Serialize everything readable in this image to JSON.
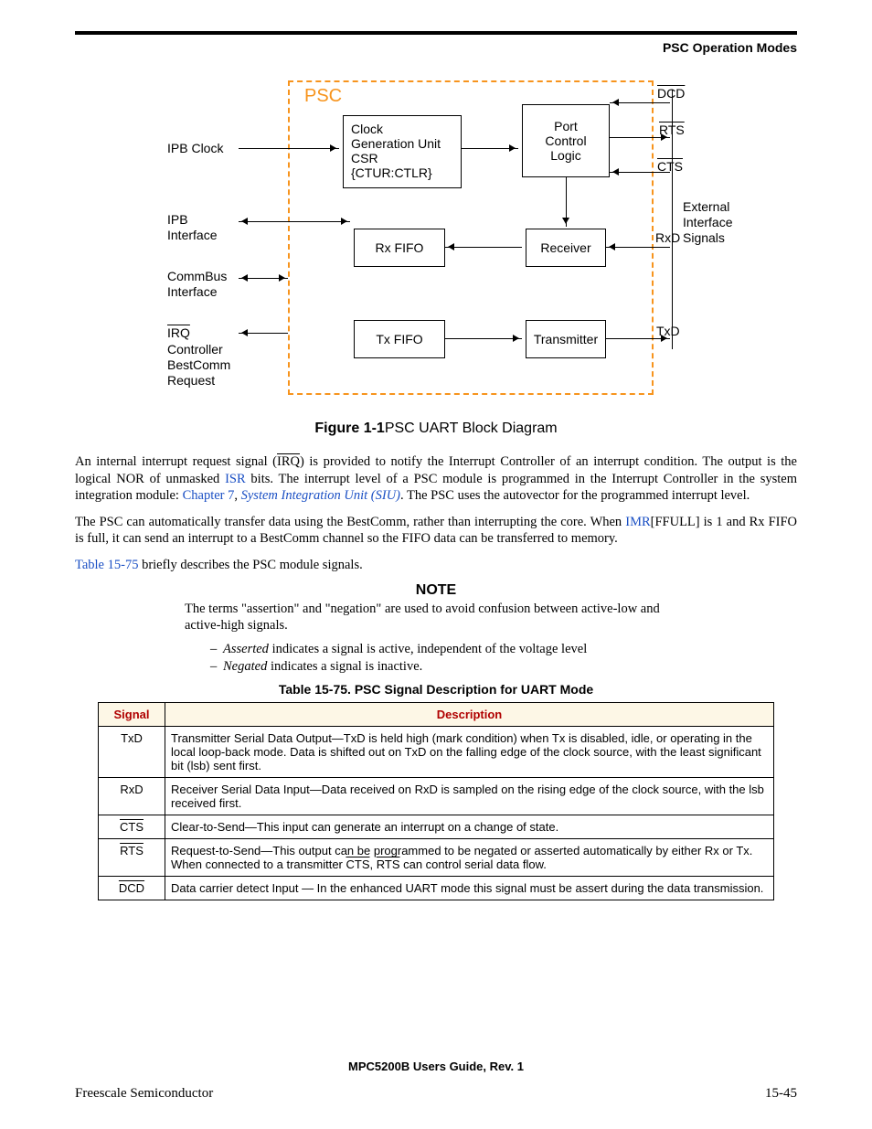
{
  "header": {
    "section": "PSC Operation Modes"
  },
  "figure": {
    "psc": "PSC",
    "left_labels": {
      "ipb_clock": "IPB Clock",
      "ipb_if": "IPB\nInterface",
      "commbus": "CommBus\nInterface",
      "irq": "IRQ",
      "ctrl": "Controller\nBestComm\nRequest"
    },
    "right_labels": {
      "dcd": "DCD",
      "rts": "RTS",
      "cts": "CTS",
      "rxd": "RxD",
      "ext": "External\nInterface\nSignals",
      "txd": "TxD"
    },
    "boxes": {
      "clock": "Clock\nGeneration Unit\nCSR\n{CTUR:CTLR}",
      "port": "Port\nControl\nLogic",
      "rxfifo": "Rx FIFO",
      "receiver": "Receiver",
      "txfifo": "Tx FIFO",
      "transmitter": "Transmitter"
    },
    "caption_bold": "Figure 1-1",
    "caption_rest": "PSC UART Block Diagram"
  },
  "para1": {
    "t1": "An internal interrupt request signal (",
    "irq": "IRQ",
    "t2": ") is provided to notify the Interrupt Controller of an interrupt condition. The output is the logical NOR of unmasked ",
    "isr": "ISR",
    "t3": " bits. The interrupt level of a PSC module is programmed in the Interrupt Controller in the system integration module: ",
    "ch7": "Chapter 7",
    "comma": ", ",
    "siu": "System Integration Unit (SIU)",
    "t4": ". The PSC uses the autovector for the programmed interrupt level."
  },
  "para2": {
    "t1": "The PSC can automatically transfer data using the BestComm, rather than interrupting the core. When ",
    "imr": "IMR",
    "t2": "[FFULL] is 1 and Rx FIFO is full, it can send an interrupt to a BestComm channel so the FIFO data can be transferred to memory."
  },
  "para3": {
    "tbl": "Table 15-75",
    "t1": " briefly describes the PSC module signals."
  },
  "note": {
    "title": "NOTE",
    "body": "The terms \"assertion\" and \"negation\" are used to avoid confusion between active-low and active-high signals.",
    "b1_i": "Asserted",
    "b1_r": " indicates a signal is active, independent of the voltage level",
    "b2_i": "Negated",
    "b2_r": " indicates a signal is inactive."
  },
  "table": {
    "caption": "Table 15-75. PSC Signal Description for UART Mode",
    "h1": "Signal",
    "h2": "Description",
    "rows": [
      {
        "sig": "TxD",
        "ov": false,
        "desc": "Transmitter Serial Data Output—TxD is held high (mark condition) when Tx is disabled, idle, or operating in the local loop-back mode. Data is shifted out on TxD on the falling edge of the clock source, with the least significant bit (lsb) sent first."
      },
      {
        "sig": "RxD",
        "ov": false,
        "desc": "Receiver Serial Data Input—Data received on RxD is sampled on the rising edge of the clock source, with the lsb received first."
      },
      {
        "sig": "CTS",
        "ov": true,
        "desc": "Clear-to-Send—This input can generate an interrupt on a change of state."
      },
      {
        "sig": "RTS",
        "ov": true,
        "desc_parts": [
          "Request-to-Send—This output can be programmed to be negated or asserted automatically by either Rx or Tx. When connected to a transmitter ",
          "CTS",
          ", ",
          "RTS",
          " can control serial data flow."
        ]
      },
      {
        "sig": "DCD",
        "ov": true,
        "desc": "Data carrier detect Input — In the enhanced UART mode this signal must be assert during the data transmission."
      }
    ]
  },
  "footer": {
    "doc": "MPC5200B Users Guide, Rev. 1",
    "left": "Freescale Semiconductor",
    "right": "15-45"
  }
}
